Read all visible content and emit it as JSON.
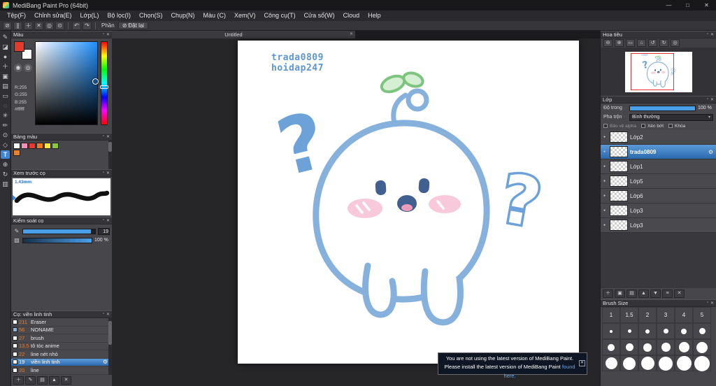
{
  "colors": {
    "titlebar": "#18181b",
    "menubar": "#2a2a2e",
    "toolbar": "#36363a",
    "toolstrip": "#303034",
    "panel": "#47474b",
    "panel-header": "#333338",
    "canvas-bg": "#262629",
    "text": "#e4e4e4",
    "accent": "#3f86d8",
    "selected-1": "#5b9ad8",
    "selected-2": "#2b69ae",
    "slider-fill": "#4aa0e8",
    "red-frame": "#e03030",
    "link": "#56a8ff",
    "notif-bg": "#0d1622",
    "number-orange": "#e87d2c",
    "art-outline": "#86b1dc",
    "art-dark": "#41608f",
    "art-cheek": "#f7c9da",
    "art-mouth": "#ef9cba",
    "art-leaf": "#d4efd2",
    "art-leaf-edge": "#7cc47f",
    "art-question": "#6da2d9",
    "art-sign": "#5e96d2"
  },
  "icons": {
    "float": "▫",
    "close": "✕",
    "caret": "▾",
    "gear": "⚙",
    "eye": "●",
    "undo": "↶",
    "redo": "↷",
    "minimize": "—",
    "maximize": "□",
    "winclose": "✕",
    "notifclose": "✕"
  },
  "window": {
    "title": "MediBang Paint Pro (64bit)"
  },
  "menu": {
    "items": [
      "Tệp(F)",
      "Chỉnh sửa(E)",
      "Lớp(L)",
      "Bộ lọc(I)",
      "Chọn(S)",
      "Chụp(N)",
      "Màu (C)",
      "Xem(V)",
      "Công cụ(T)",
      "Cửa sổ(W)",
      "Cloud",
      "Help"
    ]
  },
  "snap_toolbar": {
    "label": "Phần",
    "reset": "Đặt lại",
    "icons": [
      {
        "name": "snap-off",
        "glyph": "⊘"
      },
      {
        "name": "parallel-snap",
        "glyph": "∥"
      },
      {
        "name": "cross-snap",
        "glyph": "＋"
      },
      {
        "name": "diagonal-snap",
        "glyph": "✕"
      },
      {
        "name": "vanishing-snap",
        "glyph": "◎"
      },
      {
        "name": "radial-snap",
        "glyph": "⊙"
      }
    ]
  },
  "tools": [
    {
      "name": "brush",
      "glyph": "✎"
    },
    {
      "name": "eraser",
      "glyph": "◪"
    },
    {
      "name": "dot-pen",
      "glyph": "●"
    },
    {
      "name": "move",
      "glyph": "＋"
    },
    {
      "name": "fill",
      "glyph": "▣"
    },
    {
      "name": "gradient",
      "glyph": "▤"
    },
    {
      "name": "select",
      "glyph": "▭"
    },
    {
      "name": "lasso",
      "glyph": "◌"
    },
    {
      "name": "magic-wand",
      "glyph": "✳"
    },
    {
      "name": "select-pen",
      "glyph": "✏"
    },
    {
      "name": "eyedropper",
      "glyph": "⊙"
    },
    {
      "name": "hand",
      "glyph": "◇"
    },
    {
      "name": "text",
      "glyph": "T"
    },
    {
      "name": "zoom",
      "glyph": "⊕"
    },
    {
      "name": "rotate-canvas",
      "glyph": "↻"
    },
    {
      "name": "frame-divide",
      "glyph": "▥"
    }
  ],
  "canvas": {
    "tab_title": "Untitled",
    "signature_line1": "trada0809",
    "signature_line2": "hoidap247"
  },
  "color_panel": {
    "title": "Màu",
    "foreground": "#e23b2e",
    "background": "#ffffff",
    "r": "R:255",
    "g": "G:255",
    "b": "B:255",
    "hex": "#ffffff",
    "wheel_icon": "◉",
    "transparent_icon": "◎"
  },
  "palette_panel": {
    "title": "Bảng màu",
    "swatches": [
      "#ffffff",
      "#f48fb8",
      "#e53a2e",
      "#f07820",
      "#f5e63a",
      "#8cc63f",
      "#e88030"
    ]
  },
  "preview_panel": {
    "title": "Xem trước cọ",
    "brush_width": "1.43mm"
  },
  "control_panel": {
    "title": "Kiểm soát cọ",
    "size_icon": "✎",
    "opacity_icon": "▧",
    "size_value": "19",
    "opacity_value": "100 %"
  },
  "brush_panel": {
    "title": "Cọ: viền linh tinh",
    "brushes": [
      {
        "size": "211",
        "name": "Eraser",
        "swatch": "#ffffff",
        "selected": false
      },
      {
        "size": "56",
        "name": "NONAME",
        "swatch": "#8ab8e0",
        "selected": false
      },
      {
        "size": "27",
        "name": "brush",
        "swatch": "#ffffff",
        "selected": false
      },
      {
        "size": "13.5",
        "name": "tô tóc anime",
        "swatch": "#ffffff",
        "selected": false
      },
      {
        "size": "22",
        "name": "line nét nhỏ",
        "swatch": "#ffffff",
        "selected": false
      },
      {
        "size": "19",
        "name": "viền linh tinh",
        "swatch": "#ffffff",
        "selected": true
      },
      {
        "size": "20",
        "name": "line",
        "swatch": "#ffffff",
        "selected": false
      }
    ],
    "footer_icons": [
      {
        "name": "add-brush",
        "glyph": "＋"
      },
      {
        "name": "edit-brush",
        "glyph": "✎"
      },
      {
        "name": "brush-folder",
        "glyph": "▤"
      },
      {
        "name": "brush-up",
        "glyph": "▲"
      },
      {
        "name": "delete-brush",
        "glyph": "✕"
      }
    ]
  },
  "navigator_panel": {
    "title": "Hoa tiêu",
    "icons": [
      {
        "name": "zoom-out",
        "glyph": "⊖"
      },
      {
        "name": "zoom-in",
        "glyph": "⊕"
      },
      {
        "name": "fit-window",
        "glyph": "▭"
      },
      {
        "name": "actual-size",
        "glyph": "⌂"
      },
      {
        "name": "rotate-left",
        "glyph": "↺"
      },
      {
        "name": "rotate-right",
        "glyph": "↻"
      },
      {
        "name": "reset-view",
        "glyph": "◎"
      }
    ]
  },
  "layers_panel": {
    "title": "Lớp",
    "opacity_label": "Độ trong",
    "opacity_value": "100 %",
    "blend_label": "Pha trộn",
    "blend_value": "Bình thường",
    "protect_alpha": "Bảo vệ alpha",
    "clipping": "Xén bớt",
    "lock": "Khóa",
    "layers": [
      {
        "name": "Lớp2",
        "selected": false
      },
      {
        "name": "trada0809",
        "selected": true
      },
      {
        "name": "Lớp1",
        "selected": false
      },
      {
        "name": "Lớp5",
        "selected": false
      },
      {
        "name": "Lớp6",
        "selected": false
      },
      {
        "name": "Lớp3",
        "selected": false
      },
      {
        "name": "Lớp3",
        "selected": false
      }
    ],
    "footer_icons": [
      {
        "name": "add-layer",
        "glyph": "＋"
      },
      {
        "name": "duplicate-layer",
        "glyph": "▣"
      },
      {
        "name": "layer-folder",
        "glyph": "▤"
      },
      {
        "name": "move-layer-up",
        "glyph": "▲"
      },
      {
        "name": "move-layer-down",
        "glyph": "▼"
      },
      {
        "name": "merge-layer",
        "glyph": "≡"
      },
      {
        "name": "delete-layer",
        "glyph": "✕"
      }
    ]
  },
  "brush_size_panel": {
    "title": "Brush Size",
    "sizes": [
      "1",
      "1.5",
      "2",
      "3",
      "4",
      "5"
    ]
  },
  "notification": {
    "line1": "You are not using the latest version of MediBang Paint.",
    "line2_prefix": "Please install the latest version of MediBang Paint ",
    "link_text": "found here."
  }
}
